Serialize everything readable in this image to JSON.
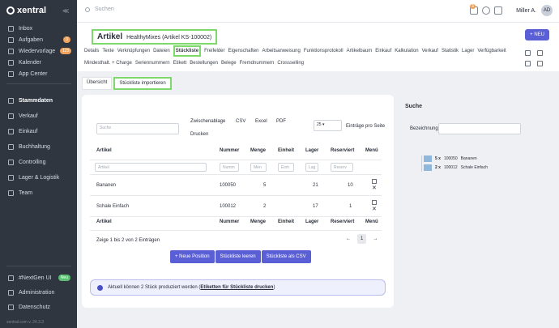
{
  "app": {
    "logo": "xentral",
    "footer": "xentral.com v. 24.3.3"
  },
  "topbar": {
    "search_placeholder": "Suchen",
    "notification_count": "3",
    "user_name": "Miller A.",
    "user_initials": "AD"
  },
  "sidebar": {
    "items": [
      {
        "label": "Inbox",
        "icon": "inbox-icon"
      },
      {
        "label": "Aufgaben",
        "icon": "tasks-icon",
        "badge": "3"
      },
      {
        "label": "Wiedervorlage",
        "icon": "resubmission-icon",
        "badge": "125"
      },
      {
        "label": "Kalender",
        "icon": "calendar-icon"
      },
      {
        "label": "App Center",
        "icon": "apps-icon"
      }
    ],
    "modules": [
      {
        "label": "Stammdaten",
        "icon": "master-data-icon"
      },
      {
        "label": "Verkauf",
        "icon": "sales-icon"
      },
      {
        "label": "Einkauf",
        "icon": "purchase-icon"
      },
      {
        "label": "Buchhaltung",
        "icon": "accounting-icon"
      },
      {
        "label": "Controlling",
        "icon": "controlling-icon"
      },
      {
        "label": "Lager & Logistik",
        "icon": "warehouse-icon"
      },
      {
        "label": "Team",
        "icon": "team-icon"
      }
    ],
    "bottom": [
      {
        "label": "#NextGen UI",
        "icon": "nextgen-icon",
        "badge": "Neu"
      },
      {
        "label": "Administration",
        "icon": "admin-icon"
      },
      {
        "label": "Datenschutz",
        "icon": "privacy-icon"
      }
    ]
  },
  "header": {
    "title": "Artikel",
    "subtitle": "HealthyMixes (Artikel KS-100002)",
    "new_button": "+ NEU"
  },
  "tabs_row1": [
    "Details",
    "Texte",
    "Verknüpfungen",
    "Dateien",
    "Stückliste",
    "Freifelder",
    "Eigenschaften",
    "Arbeitsanweisung",
    "Funktionsprotokoll",
    "Artikelbaum",
    "Einkauf",
    "Kalkulation",
    "Verkauf",
    "Statistik",
    "Lager",
    "Verfügbarkeit"
  ],
  "tabs_row2": [
    "Mindesthalt. + Charge",
    "Seriennummern",
    "Etikett",
    "Bestellungen",
    "Belege",
    "Fremdnummern",
    "Crossselling"
  ],
  "active_tab": "Stückliste",
  "subtabs": {
    "overview": "Übersicht",
    "import": "Stückliste importieren"
  },
  "table_tools": {
    "search_placeholder": "Suche",
    "exports": [
      "Zwischenablage",
      "CSV",
      "Excel",
      "PDF",
      "Drucken"
    ],
    "page_size": "25",
    "page_size_label": "Einträge pro Seite"
  },
  "table": {
    "columns": [
      "Artikel",
      "Nummer",
      "Menge",
      "Einheit",
      "Lager",
      "Reserviert",
      "Menü"
    ],
    "filters": [
      "Artikel",
      "Numm",
      "Men",
      "Einh",
      "Lag",
      "Reserv"
    ],
    "rows": [
      {
        "artikel": "Bananen",
        "nummer": "100050",
        "menge": "5",
        "einheit": "",
        "lager": "21",
        "reserviert": "10"
      },
      {
        "artikel": "Schale Einfach",
        "nummer": "100012",
        "menge": "2",
        "einheit": "",
        "lager": "17",
        "reserviert": "1"
      }
    ],
    "info": "Zeige 1 bis 2 von 2 Einträgen",
    "page": "1"
  },
  "buttons": {
    "new_position": "+ Neue Position",
    "clear": "Stückliste leeren",
    "csv": "Stückliste als CSV"
  },
  "info_box": {
    "text": "Aktuell können 2 Stück produziert werden (",
    "link": "Etiketten für Stückliste drucken",
    "tail": ")"
  },
  "side_panel": {
    "title": "Suche",
    "label": "Bezeichnung:"
  },
  "tree": [
    {
      "qty": "5 x",
      "number": "100050",
      "name": "Bananen"
    },
    {
      "qty": "2 x",
      "number": "100012",
      "name": "Schale Einfach"
    }
  ]
}
